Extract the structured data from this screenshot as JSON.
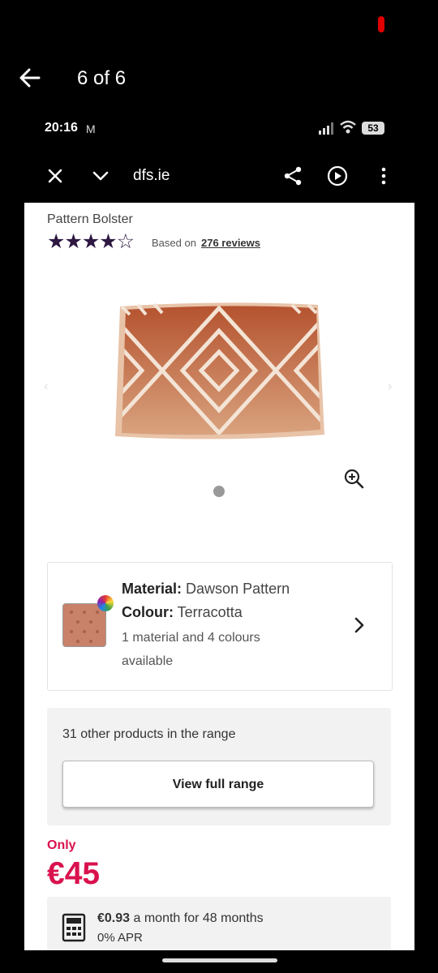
{
  "gallery": {
    "counter": "6 of 6"
  },
  "status_bar": {
    "time": "20:16",
    "notification_icon": "M",
    "battery": "53"
  },
  "browser": {
    "url": "dfs.ie"
  },
  "product": {
    "title": "Pattern Bolster",
    "rating": {
      "stars_display": "★★★★☆",
      "value_out_of_5": 4.5,
      "based_on": "Based on",
      "reviews_link": "276 reviews"
    },
    "carousel": {
      "dots": 1,
      "active_index": 0
    }
  },
  "material_card": {
    "material_label": "Material:",
    "material_value": "Dawson Pattern",
    "colour_label": "Colour:",
    "colour_value": "Terracotta",
    "availability": "1 material and 4 colours available"
  },
  "range": {
    "text": "31 other products in the range",
    "button_label": "View full range"
  },
  "pricing": {
    "only_label": "Only",
    "price": "€45",
    "finance_amount": "€0.93",
    "finance_text": "a month for 48 months",
    "apr": "0% APR"
  },
  "colors": {
    "price_accent": "#d9124e",
    "star_color": "#2e1842",
    "cushion": "#b9603d"
  }
}
